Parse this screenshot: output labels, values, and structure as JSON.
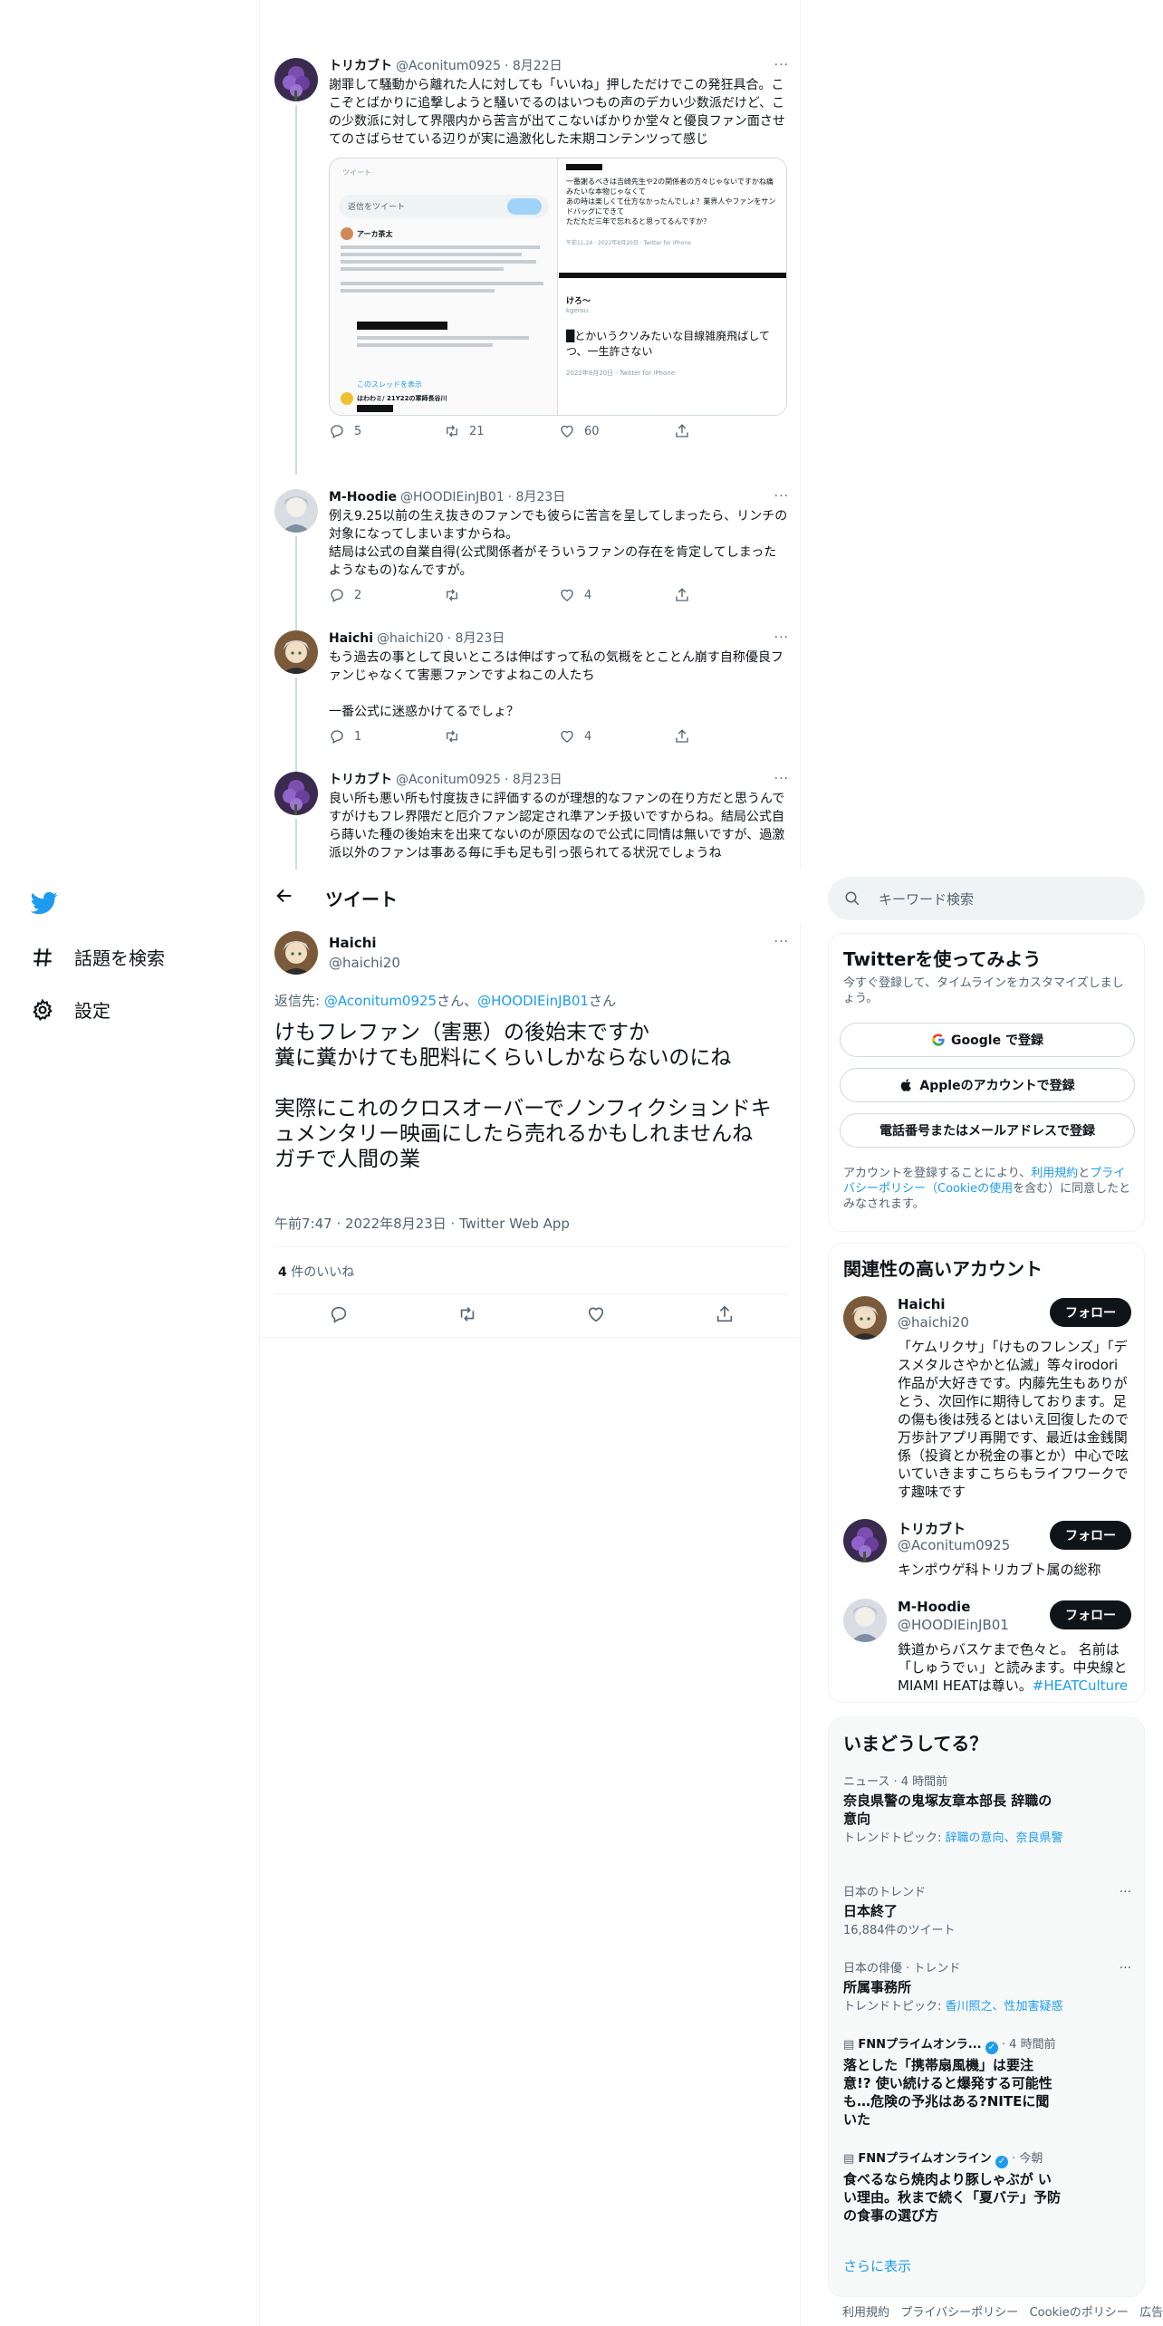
{
  "nav": {
    "explore_label": "話題を検索",
    "settings_label": "設定"
  },
  "thread": [
    {
      "name": "トリカブト",
      "handle": "@Aconitum0925",
      "date": "· 8月22日",
      "more": "···",
      "text": "謝罪して騒動から離れた人に対しても「いいね」押しただけでこの発狂具合。ここぞとばかりに追撃しようと騒いでるのはいつもの声のデカい少数派だけど、この少数派に対して界隈内から苦言が出てこないばかりか堂々と優良ファン面させてのさばらせている辺りが実に過激化した末期コンテンツって感じ",
      "media": {
        "left_lines": [
          "ツイート",
          "返信をツイート",
          "アーカ茶太",
          "このスレッドを表示",
          "はわわミ/ 21Y22の軍師長谷川",
          "@ACT 2022"
        ],
        "right_lines": [
          "一番謝るべきは吉崎先生や2の関係者の方々じゃないですかね痛みたいな本物じゃなくて",
          "あの時は楽しくて仕方なかったんでしょ？業界人やファンをサンドバッグにできて",
          "ただただ三年で忘れると思ってるんですか？",
          "午前11:24 · 2022年8月20日 · Twitter for iPhone",
          "けろ〜",
          "kgerou",
          "█とかいうクソみたいな目線雑廃飛ばしてつ、一生許さない",
          "2022年8月20日 · Twitter for iPhone"
        ]
      },
      "replies": "5",
      "retweets": "21",
      "likes": "60"
    },
    {
      "name": "M-Hoodie",
      "handle": "@HOODIEinJB01",
      "date": "· 8月23日",
      "more": "···",
      "text": "例え9.25以前の生え抜きのファンでも彼らに苦言を呈してしまったら、リンチの対象になってしまいますからね。\n結局は公式の自業自得(公式関係者がそういうファンの存在を肯定してしまったようなもの)なんですが。",
      "replies": "2",
      "retweets": "",
      "likes": "4"
    },
    {
      "name": "Haichi",
      "handle": "@haichi20",
      "date": "· 8月23日",
      "more": "···",
      "text": "もう過去の事として良いところは伸ばすって私の気概をとことん崩す自称優良ファンじゃなくて害悪ファンですよねこの人たち\n\n一番公式に迷惑かけてるでしょ？",
      "replies": "1",
      "retweets": "",
      "likes": "4"
    },
    {
      "name": "トリカブト",
      "handle": "@Aconitum0925",
      "date": "· 8月23日",
      "more": "···",
      "text": "良い所も悪い所も忖度抜きに評価するのが理想的なファンの在り方だと思うんですがけもフレ界隈だと厄介ファン認定され準アンチ扱いですからね。結局公式自ら蒔いた種の後始末を出来てないのが原因なので公式に同情は無いですが、過激派以外のファンは事ある毎に手も足も引っ張られてる状況でしょうね"
    }
  ],
  "detail_header": {
    "title": "ツイート"
  },
  "main_tweet": {
    "name": "Haichi",
    "handle": "@haichi20",
    "more": "···",
    "reply_prefix": "返信先: ",
    "reply_to_1": "@Aconitum0925",
    "reply_join": "さん、",
    "reply_to_2": "@HOODIEinJB01",
    "reply_suffix": "さん",
    "text": "けもフレファン（害悪）の後始末ですか\n糞に糞かけても肥料にくらいしかならないのにね\n\n実際にこれのクロスオーバーでノンフィクションドキュメンタリー映画にしたら売れるかもしれませんね\nガチで人間の業",
    "meta": "午前7:47 · 2022年8月23日 · Twitter Web App",
    "like_count": "4",
    "like_label": " 件のいいね"
  },
  "search": {
    "placeholder": "キーワード検索"
  },
  "signup": {
    "title": "Twitterを使ってみよう",
    "subtitle": "今すぐ登録して、タイムラインをカスタマイズしましょう。",
    "google": "Google で登録",
    "apple": "Appleのアカウントで登録",
    "phone": "電話番号またはメールアドレスで登録",
    "legal_prefix": "アカウントを登録することにより、",
    "legal_terms": "利用規約",
    "legal_and": "と",
    "legal_privacy": "プライバシーポリシー",
    "legal_cookie": "（Cookieの使用",
    "legal_suffix": "を含む）に同意したとみなされます。"
  },
  "recs": {
    "title": "関連性の高いアカウント",
    "follow_label": "フォロー",
    "items": [
      {
        "name": "Haichi",
        "handle": "@haichi20",
        "bio": "「ケムリクサ」「けものフレンズ」「デスメタルさやかと仏滅」等々irodori作品が大好きです。内藤先生もありがとう、次回作に期待しております。足の傷も後は残るとはいえ回復したので万歩計アプリ再開です、最近は金銭関係（投資とか税金の事とか）中心で呟いていきますこちらもライフワークです趣味です"
      },
      {
        "name": "トリカブト",
        "handle": "@Aconitum0925",
        "bio": "キンポウゲ科トリカブト属の総称"
      },
      {
        "name": "M-Hoodie",
        "handle": "@HOODIEinJB01",
        "bio": "鉄道からバスケまで色々と。 名前は「しゅうでぃ」と読みます。中央線とMIAMI HEATは尊い。",
        "bio_tag": "#HEATCulture"
      }
    ]
  },
  "trends": {
    "title": "いまどうしてる？",
    "items": [
      {
        "context": "ニュース · 4 時間前",
        "title": "奈良県警の鬼塚友章本部長 辞職の意向",
        "sub_prefix": "トレンドトピック: ",
        "sub_links": "辞職の意向、奈良県警"
      },
      {
        "context": "日本のトレンド",
        "title": "日本終了",
        "sub": "16,884件のツイート"
      },
      {
        "context": "日本の俳優 · トレンド",
        "title": "所属事務所",
        "sub_prefix": "トレンドトピック: ",
        "sub_links": "香川照之、性加害疑惑"
      },
      {
        "context": "FNNプライムオンラ...",
        "context_time": " · 4 時間前",
        "title": "落とした「携帯扇風機」は要注意!? 使い続けると爆発する可能性も…危険の予兆はある?NITEに聞いた"
      },
      {
        "context": "FNNプライムオンライン",
        "context_time": " · 今朝",
        "title": "食べるなら焼肉より豚しゃぶが いい理由。秋まで続く「夏バテ」予防の食事の選び方"
      }
    ],
    "show_more": "さらに表示"
  },
  "footer": {
    "terms": "利用規約",
    "privacy": "プライバシーポリシー",
    "cookie": "Cookieのポリシー",
    "more": "広告情報"
  },
  "colors": {
    "accent": "#1d9bf0",
    "text": "#0f1419",
    "muted": "#536471",
    "border": "#eff3f4"
  }
}
